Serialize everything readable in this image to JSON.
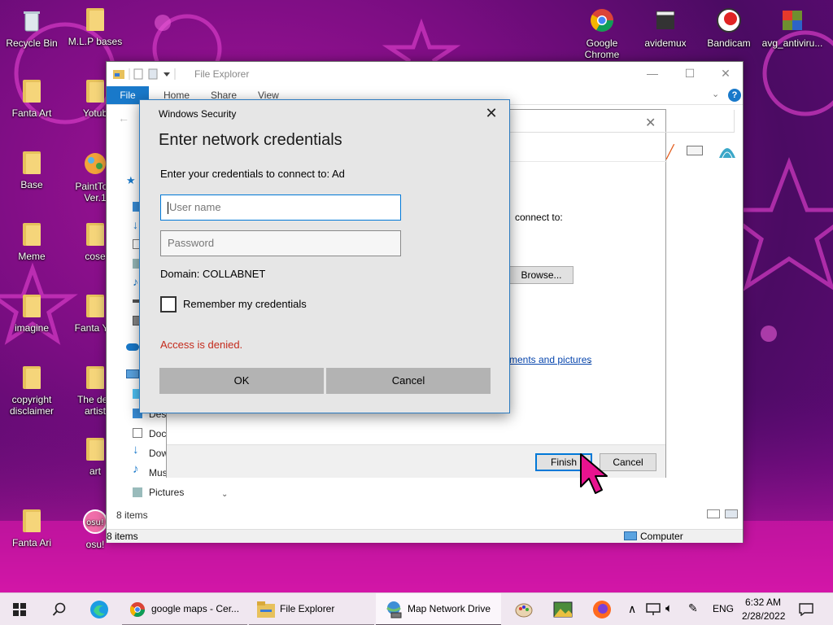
{
  "desktop": {
    "icons_left": [
      {
        "label": "Recycle Bin",
        "icon": "recycle-bin-icon"
      },
      {
        "label": "M.L.P bases",
        "icon": "folder-icon"
      },
      {
        "label": "Fanta Art",
        "icon": "folder-icon"
      },
      {
        "label": "Yotub",
        "icon": "folder-icon"
      },
      {
        "label": "Base",
        "icon": "folder-icon"
      },
      {
        "label": "PaintTool",
        "sublabel": "Ver.1",
        "icon": "painttool-icon"
      },
      {
        "label": "Meme",
        "icon": "folder-icon"
      },
      {
        "label": "cose",
        "icon": "folder-icon"
      },
      {
        "label": "imagine",
        "icon": "folder-icon"
      },
      {
        "label": "Fanta Yot",
        "icon": "folder-icon"
      },
      {
        "label": "copyright",
        "sublabel": "disclaimer",
        "icon": "folder-icon"
      },
      {
        "label": "The dea",
        "sublabel": "artist",
        "icon": "folder-icon"
      },
      {
        "label": "art",
        "icon": "folder-icon"
      },
      {
        "label": "Fanta Ari",
        "icon": "folder-icon"
      },
      {
        "label": "osu!",
        "icon": "osu-icon"
      }
    ],
    "icons_right": [
      {
        "label": "Google",
        "sublabel": "Chrome",
        "icon": "chrome-icon"
      },
      {
        "label": "avidemux",
        "icon": "avidemux-icon"
      },
      {
        "label": "Bandicam",
        "icon": "bandicam-icon"
      },
      {
        "label": "avg_antiviru...",
        "icon": "avg-antivirus-icon"
      }
    ]
  },
  "explorer": {
    "title": "File Explorer",
    "tabs": {
      "file": "File",
      "home": "Home",
      "share": "Share",
      "view": "View"
    },
    "sidebar": [
      "Desk",
      "Docu",
      "Dow",
      "Mus",
      "Pictures"
    ],
    "status_items": "8 items",
    "status_items_bottom": "8 items",
    "status_computer": "Computer"
  },
  "wizard": {
    "connect_text": "connect to:",
    "browse_label": "Browse...",
    "link_text": "ments and pictures",
    "link_tail": ".",
    "finish_label": "Finish",
    "cancel_label": "Cancel"
  },
  "security": {
    "caption": "Windows Security",
    "heading": "Enter network credentials",
    "prompt": "Enter your credentials to connect to: Ad",
    "username_placeholder": "User name",
    "password_placeholder": "Password",
    "domain": "Domain: COLLABNET",
    "remember_label": "Remember my credentials",
    "error": "Access is denied.",
    "ok_label": "OK",
    "cancel_label": "Cancel"
  },
  "taskbar": {
    "items": [
      {
        "label": "google maps - Cer...",
        "icon": "chrome-icon"
      },
      {
        "label": "File Explorer",
        "icon": "file-explorer-icon"
      },
      {
        "label": "Map Network Drive",
        "icon": "network-drive-icon"
      }
    ],
    "lang": "ENG",
    "time": "6:32 AM",
    "date": "2/28/2022"
  },
  "colors": {
    "accent": "#0078d7",
    "error": "#c42b1c",
    "ribbon_file": "#1979ca",
    "desktop_bg": "#7a0d82"
  }
}
